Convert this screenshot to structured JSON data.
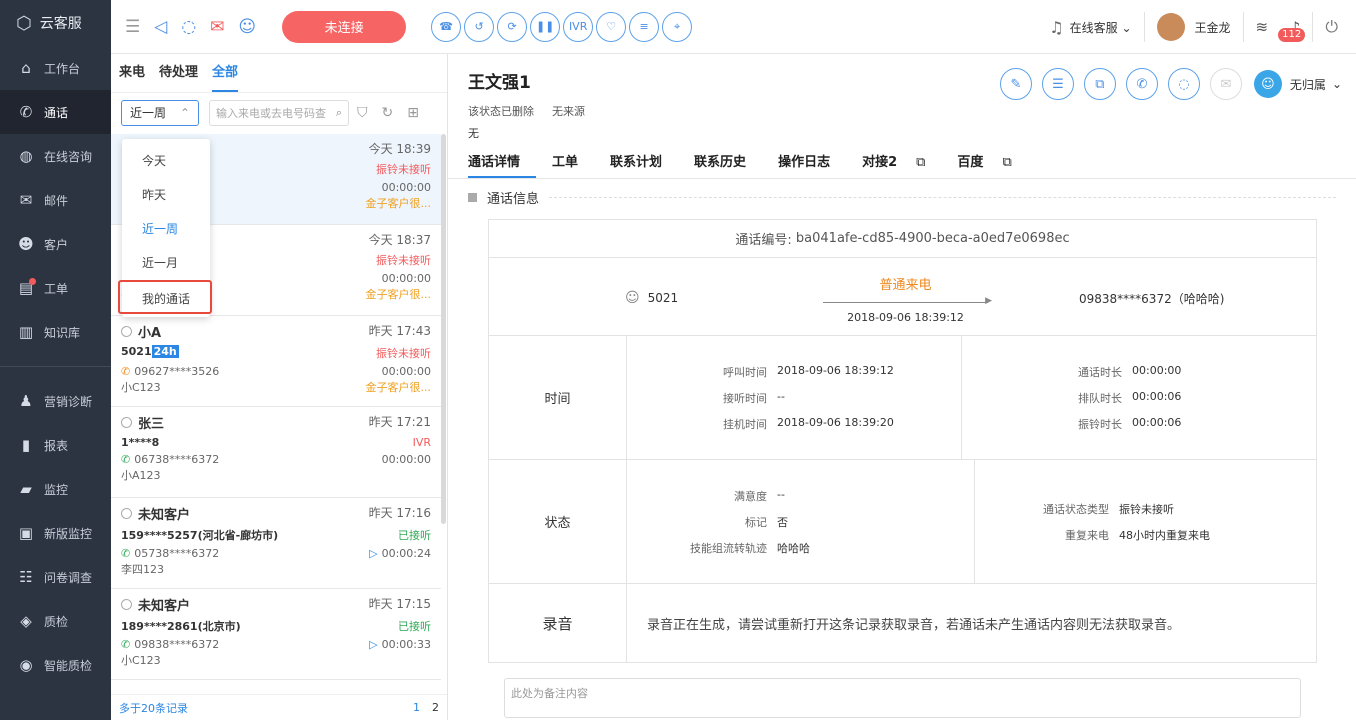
{
  "app": {
    "name": "云客服"
  },
  "sidebar": {
    "items": [
      {
        "icon": "home-icon",
        "glyph": "⌂",
        "label": "工作台"
      },
      {
        "icon": "phone-icon",
        "glyph": "✆",
        "label": "通话",
        "active": true
      },
      {
        "icon": "chat-icon",
        "glyph": "◍",
        "label": "在线咨询"
      },
      {
        "icon": "mail-icon",
        "glyph": "✉",
        "label": "邮件"
      },
      {
        "icon": "user-icon",
        "glyph": "☻",
        "label": "客户"
      },
      {
        "icon": "ticket-icon",
        "glyph": "▤",
        "label": "工单",
        "dot": true
      },
      {
        "icon": "book-icon",
        "glyph": "▥",
        "label": "知识库"
      }
    ],
    "items2": [
      {
        "icon": "diagnose-icon",
        "glyph": "♟",
        "label": "营销诊断"
      },
      {
        "icon": "report-icon",
        "glyph": "▮",
        "label": "报表"
      },
      {
        "icon": "monitor-icon",
        "glyph": "▰",
        "label": "监控"
      },
      {
        "icon": "new-monitor-icon",
        "glyph": "▣",
        "label": "新版监控"
      },
      {
        "icon": "survey-icon",
        "glyph": "☷",
        "label": "问卷调查"
      },
      {
        "icon": "quality-icon",
        "glyph": "◈",
        "label": "质检"
      },
      {
        "icon": "smart-quality-icon",
        "glyph": "◉",
        "label": "智能质检"
      }
    ]
  },
  "topbar": {
    "connect_label": "未连接",
    "agent_status": "在线客服",
    "user_name": "王金龙",
    "notif_count": "112"
  },
  "list": {
    "tabs": [
      "来电",
      "待处理",
      "全部"
    ],
    "active_tab": 2,
    "period": "近一周",
    "search_placeholder": "输入来电或去电号码查",
    "footer_more": "多于20条记录",
    "pages": [
      "1",
      "2"
    ],
    "items": [
      {
        "name": "",
        "time": "今天 18:39",
        "number": "",
        "status": "振铃未接听",
        "status_type": "red",
        "phone": "",
        "duration": "00:00:00",
        "owner": ":)",
        "note": "金子客户很...",
        "selected": true
      },
      {
        "name": "",
        "time": "今天 18:37",
        "number": "",
        "status": "振铃未接听",
        "status_type": "red",
        "phone": "",
        "duration": "00:00:00",
        "owner": "3",
        "note": "金子客户很..."
      },
      {
        "name": "小A",
        "time": "昨天 17:43",
        "number": "5021",
        "tag": "24h",
        "status": "振铃未接听",
        "status_type": "red",
        "phone": "09627****3526",
        "phone_type": "o",
        "duration": "00:00:00",
        "owner": "小C123",
        "note": "金子客户很..."
      },
      {
        "name": "张三",
        "time": "昨天 17:21",
        "number": "1****8",
        "status": "IVR",
        "status_type": "red",
        "phone": "06738****6372",
        "phone_type": "g",
        "duration": "00:00:00",
        "owner": "小A123",
        "note": ""
      },
      {
        "name": "未知客户",
        "time": "昨天 17:16",
        "number": "159****5257(河北省-廊坊市)",
        "status": "已接听",
        "status_type": "green",
        "phone": "05738****6372",
        "phone_type": "g",
        "duration": "00:00:24",
        "play": true,
        "owner": "李四123",
        "note": ""
      },
      {
        "name": "未知客户",
        "time": "昨天 17:15",
        "number": "189****2861(北京市)",
        "status": "已接听",
        "status_type": "green",
        "phone": "09838****6372",
        "phone_type": "g",
        "duration": "00:00:33",
        "play": true,
        "owner": "小C123",
        "note": ""
      }
    ]
  },
  "dropdown": {
    "options": [
      "今天",
      "昨天",
      "近一周",
      "近一月",
      "我的通话"
    ],
    "current": 2,
    "highlighted": 4
  },
  "detail": {
    "name": "王文强1",
    "sub1": "该状态已删除",
    "sub2": "无来源",
    "sub3": "无",
    "owner": "无归属",
    "tabs": [
      {
        "label": "通话详情",
        "on": true
      },
      {
        "label": "工单"
      },
      {
        "label": "联系计划"
      },
      {
        "label": "联系历史"
      },
      {
        "label": "操作日志"
      },
      {
        "label": "对接2",
        "ext": true
      },
      {
        "label": "百度",
        "ext": true
      }
    ],
    "section_title": "通话信息",
    "call_no_label": "通话编号:",
    "call_no": "ba041afe-cd85-4900-beca-a0ed7e0698ec",
    "from_ext": "5021",
    "call_type": "普通来电",
    "call_time": "2018-09-06 18:39:12",
    "to_number": "09838****6372（哈哈哈)",
    "time_label": "时间",
    "time_left": [
      {
        "k": "呼叫时间",
        "v": "2018-09-06 18:39:12"
      },
      {
        "k": "接听时间",
        "v": "--"
      },
      {
        "k": "挂机时间",
        "v": "2018-09-06 18:39:20"
      }
    ],
    "time_right": [
      {
        "k": "通话时长",
        "v": "00:00:00"
      },
      {
        "k": "排队时长",
        "v": "00:00:06"
      },
      {
        "k": "振铃时长",
        "v": "00:00:06"
      }
    ],
    "status_label": "状态",
    "status_left": [
      {
        "k": "满意度",
        "v": "--"
      },
      {
        "k": "标记",
        "v": "否"
      },
      {
        "k": "技能组流转轨迹",
        "v": "哈哈哈"
      }
    ],
    "status_right": [
      {
        "k": "通话状态类型",
        "v": "振铃未接听"
      },
      {
        "k": "重复来电",
        "v": "48小时内重复来电"
      }
    ],
    "record_label": "录音",
    "record_text": "录音正在生成，请尝试重新打开这条记录获取录音，若通话未产生通话内容则无法获取录音。",
    "note_placeholder": "此处为备注内容"
  }
}
